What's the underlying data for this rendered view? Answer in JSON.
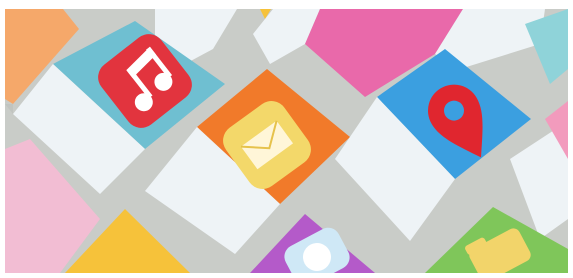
{
  "photo": {
    "subject": "paper-craft-app-icons",
    "icons": [
      {
        "name": "music-note-icon",
        "tile": "#6fbfd1",
        "badge": "#e2343e",
        "glyph": "#ffffff"
      },
      {
        "name": "envelope-icon",
        "tile": "#f17a2a",
        "badge": "#f3d86a",
        "glyph": "#fff6d8"
      },
      {
        "name": "map-pin-icon",
        "tile": "#3b9fe0",
        "badge": "#e0262f",
        "glyph": "#3b9fe0"
      },
      {
        "name": "chat-bubble-icon",
        "tile": "#b45ac9",
        "badge": "#cfe8f6",
        "glyph": "#ffffff"
      },
      {
        "name": "folder-icon",
        "tile": "#7fc65a",
        "badge": "#f2d46a",
        "glyph": "#f2d46a"
      }
    ],
    "colors": {
      "background": "#c9ccc8",
      "card": "#eef3f6",
      "pink": "#e969aa",
      "light_pink": "#f2bdd3",
      "peach": "#f5a86a",
      "yellow": "#f6c23a",
      "teal": "#8fd3d9"
    }
  }
}
